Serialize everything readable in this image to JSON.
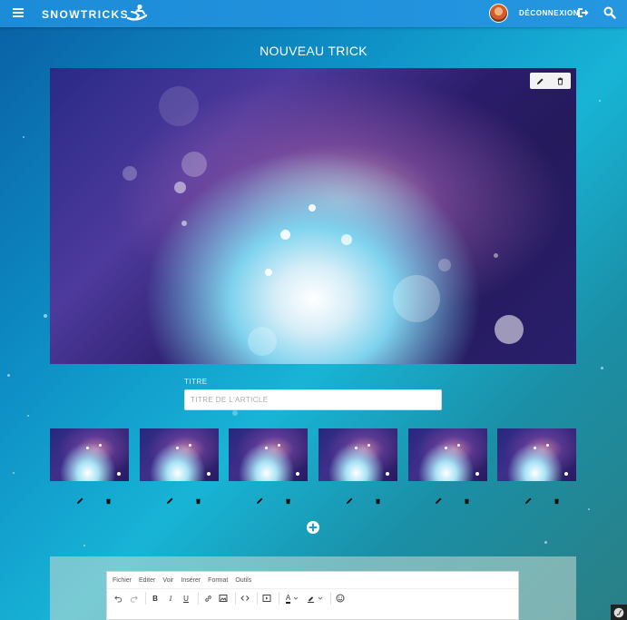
{
  "navbar": {
    "brand": "SNOWTRICKS",
    "logout_label": "DÉCONNEXION",
    "icons": [
      "menu-icon",
      "snowboarder-logo-icon",
      "avatar",
      "logout-icon",
      "search-icon"
    ]
  },
  "page": {
    "title": "NOUVEAU TRICK"
  },
  "hero": {
    "actions": [
      "edit-icon",
      "delete-icon"
    ]
  },
  "form": {
    "title_label": "TITRE",
    "title_placeholder": "TITRE DE L'ARTICLE",
    "title_value": ""
  },
  "thumbnails": [
    {
      "actions": [
        "edit-icon",
        "delete-icon"
      ]
    },
    {
      "actions": [
        "edit-icon",
        "delete-icon"
      ]
    },
    {
      "actions": [
        "edit-icon",
        "delete-icon"
      ]
    },
    {
      "actions": [
        "edit-icon",
        "delete-icon"
      ]
    },
    {
      "actions": [
        "edit-icon",
        "delete-icon"
      ]
    },
    {
      "actions": [
        "edit-icon",
        "delete-icon"
      ]
    }
  ],
  "editor": {
    "menu": [
      "Fichier",
      "Editer",
      "Voir",
      "Insérer",
      "Format",
      "Outils"
    ],
    "toolbar": {
      "bold": "B",
      "italic": "I",
      "underline": "U",
      "text_color": "A"
    }
  },
  "colors": {
    "navbar": "#1c8cd8",
    "background_start": "#0a5fa3",
    "background_end": "#2a7f84"
  }
}
